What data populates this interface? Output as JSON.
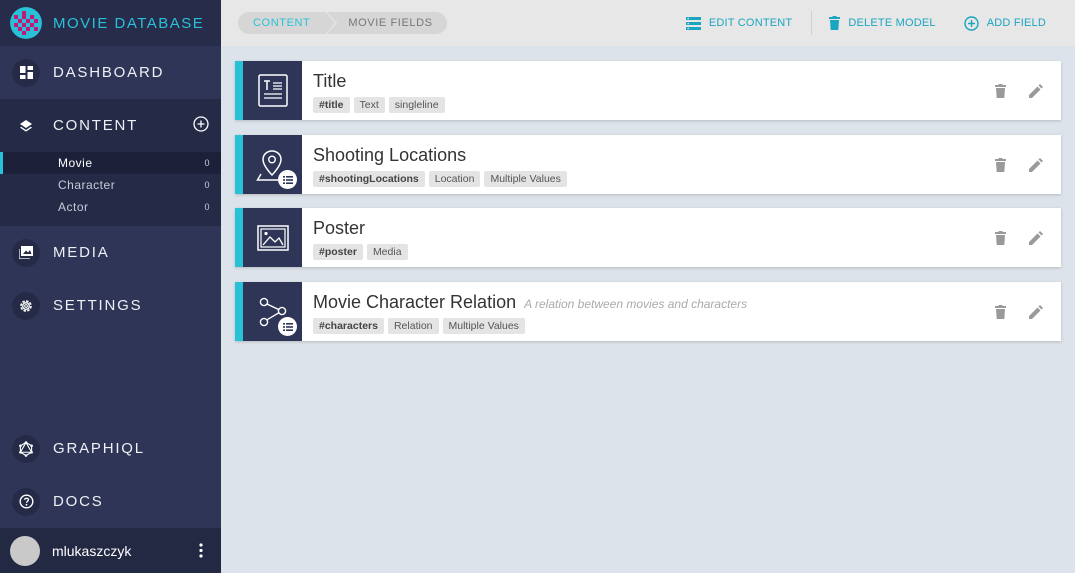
{
  "app": {
    "title": "MOVIE DATABASE",
    "logo_icon": "checker-globe-logo"
  },
  "colors": {
    "accent": "#29c1d8",
    "sidebar": "#2e3556",
    "background": "#dde3ea"
  },
  "sidebar": {
    "nav": [
      {
        "label": "DASHBOARD",
        "icon": "dashboard-icon"
      },
      {
        "label": "CONTENT",
        "icon": "layers-icon"
      },
      {
        "label": "MEDIA",
        "icon": "image-icon"
      },
      {
        "label": "SETTINGS",
        "icon": "gear-icon"
      }
    ],
    "models": [
      {
        "label": "Movie",
        "count": "0"
      },
      {
        "label": "Character",
        "count": "0"
      },
      {
        "label": "Actor",
        "count": "0"
      }
    ],
    "bottom": [
      {
        "label": "GRAPHIQL",
        "icon": "graphql-icon"
      },
      {
        "label": "DOCS",
        "icon": "help-icon"
      }
    ],
    "user": {
      "name": "mlukaszczyk"
    }
  },
  "breadcrumb": {
    "first": "CONTENT",
    "second": "MOVIE FIELDS"
  },
  "toolbar": {
    "edit_content": "EDIT CONTENT",
    "delete_model": "DELETE MODEL",
    "add_field": "ADD FIELD"
  },
  "fields": [
    {
      "name": "Title",
      "description": "",
      "api_id": "#title",
      "type": "Text",
      "extra": "singleline",
      "icon": "text-field-icon",
      "list": false
    },
    {
      "name": "Shooting Locations",
      "description": "",
      "api_id": "#shootingLocations",
      "type": "Location",
      "extra": "Multiple Values",
      "icon": "location-pin-icon",
      "list": true
    },
    {
      "name": "Poster",
      "description": "",
      "api_id": "#poster",
      "type": "Media",
      "extra": "",
      "icon": "image-field-icon",
      "list": false
    },
    {
      "name": "Movie Character Relation",
      "description": "A relation between movies and characters",
      "api_id": "#characters",
      "type": "Relation",
      "extra": "Multiple Values",
      "icon": "relation-icon",
      "list": true
    }
  ]
}
